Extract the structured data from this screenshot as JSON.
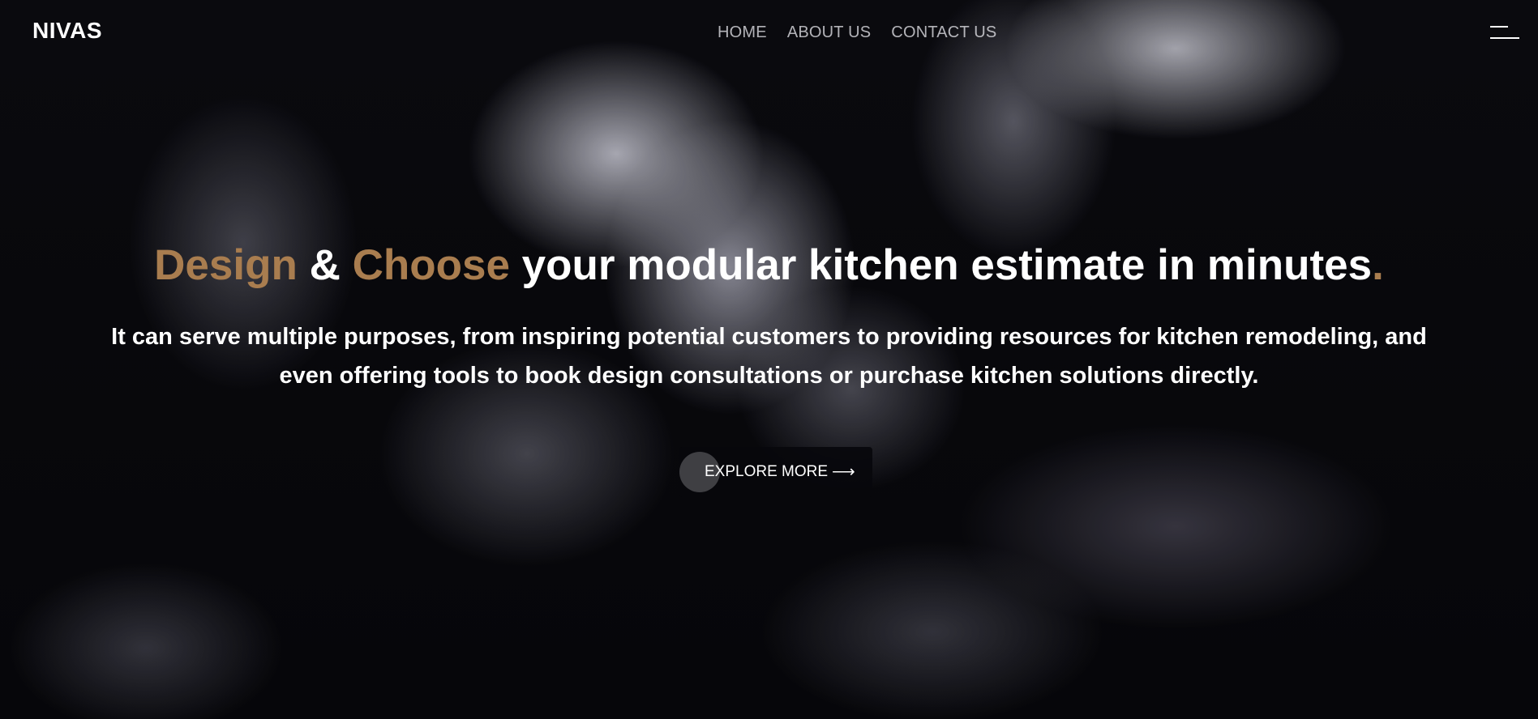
{
  "brand": {
    "logo": "NIVAS"
  },
  "nav": {
    "items": [
      {
        "label": "HOME"
      },
      {
        "label": "ABOUT US"
      },
      {
        "label": "CONTACT US"
      }
    ],
    "menu_icon": "hamburger-menu-icon"
  },
  "hero": {
    "title_part1": "Design",
    "title_amp": " & ",
    "title_part2": "Choose",
    "title_rest": " your modular kitchen estimate in minutes",
    "title_period": ".",
    "subtitle_line1": "It can serve multiple purposes, from inspiring potential customers to providing resources for kitchen remodeling, and",
    "subtitle_line2": "even offering tools to book design consultations or purchase kitchen solutions directly.",
    "cta_label": "EXPLORE MORE",
    "cta_icon": "arrow-right-icon"
  },
  "colors": {
    "accent": "#a97d4f",
    "text": "#ffffff",
    "background": "#050508"
  }
}
